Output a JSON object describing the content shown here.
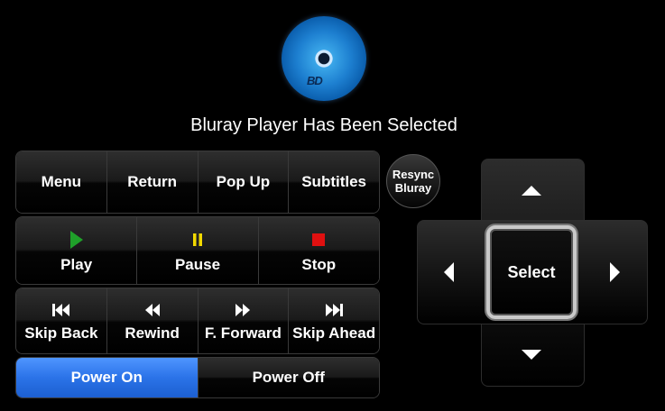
{
  "header": {
    "logo_icon": "bluray-disc-logo",
    "status_text": "Bluray Player Has Been Selected"
  },
  "nav_row": [
    "Menu",
    "Return",
    "Pop Up",
    "Subtitles"
  ],
  "transport_row": [
    {
      "label": "Play",
      "icon": "play-icon",
      "color": "#1fa12a"
    },
    {
      "label": "Pause",
      "icon": "pause-icon",
      "color": "#f2d900"
    },
    {
      "label": "Stop",
      "icon": "stop-icon",
      "color": "#e01010"
    }
  ],
  "skip_row": [
    {
      "label": "Skip Back",
      "icon": "skip-back-icon"
    },
    {
      "label": "Rewind",
      "icon": "rewind-icon"
    },
    {
      "label": "F. Forward",
      "icon": "fast-forward-icon"
    },
    {
      "label": "Skip Ahead",
      "icon": "skip-ahead-icon"
    }
  ],
  "power_row": {
    "on_label": "Power On",
    "off_label": "Power Off",
    "active_color": "#2b73e8"
  },
  "resync": {
    "line1": "Resync",
    "line2": "Bluray"
  },
  "dpad": {
    "select_label": "Select"
  }
}
